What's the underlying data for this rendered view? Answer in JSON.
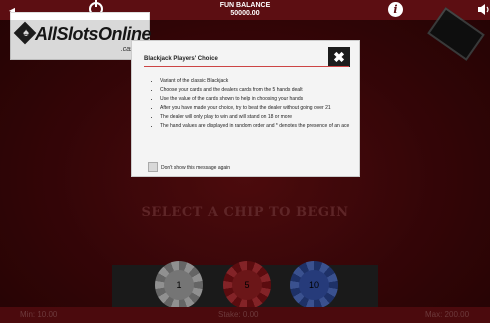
{
  "header": {
    "balance_label": "FUN BALANCE",
    "balance_value": "50000.00"
  },
  "logo": {
    "text": "AllSlotsOnline",
    "sub": ".casino"
  },
  "table": {
    "prompt": "SELECT A CHIP TO BEGIN"
  },
  "chips": [
    {
      "value": "1",
      "color": "#8a8a8a"
    },
    {
      "value": "5",
      "color": "#7e1a1d"
    },
    {
      "value": "10",
      "color": "#2d4690"
    }
  ],
  "footer": {
    "left": "Min: 10.00",
    "center": "Stake: 0.00",
    "right": "Max: 200.00"
  },
  "modal": {
    "title": "Blackjack Players' Choice",
    "close_label": "✖",
    "rules": [
      "Variant of the classic Blackjack",
      "Choose your cards and the dealers cards from the 5 hands dealt",
      "Use the value of the cards shown to help in choosing your hands",
      "After you have made your choice, try to beat the dealer without going over 21",
      "The dealer will only play to win and will stand on 18 or more",
      "The hand values are displayed in random order and * denotes the presence of an ace"
    ],
    "checkbox_label": "Don't show this message again"
  },
  "colors": {
    "felt": "#3d0709",
    "topbar": "#5c0e12",
    "accent_rule": "#cc4444"
  },
  "icons": {
    "power": "power-icon",
    "info": "info-icon",
    "sound": "sound-icon",
    "close": "close-icon"
  }
}
